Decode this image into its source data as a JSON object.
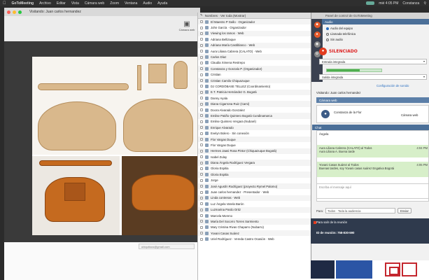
{
  "menubar": {
    "app": "GoToMeeting",
    "items": [
      "Archivo",
      "Editar",
      "Vista",
      "Cámara web",
      "Zoom",
      "Ventana",
      "Audio",
      "Ayuda"
    ],
    "clock": "mié 4:05 PM",
    "user": "Constanza"
  },
  "viewer": {
    "title": "Visitando: Juan carlos hernandez",
    "tool_label": "Cámara web",
    "bottom_chip": "ubiquitous@gmail.com"
  },
  "plist": {
    "header": "Nombres · Ver toda (Mostrar)",
    "participants": [
      "El Maestro P Gallo · Organizador",
      "John García · Organizador",
      "Viewing los ramos · Web",
      "Adriana Bellizaque",
      "Adriana María Castiblanco · Web",
      "Aura Liliana Cabrera (CALATO) · Web",
      "Carlos Díaz",
      "Claudia Ximena Restrepo",
      "Constanza y Gonzalo P. (Organizador)",
      "Cristian",
      "Cristian Camilo Chiquazuque",
      "DJ CORDÓBASE TELLEZ (Coordinamiento)",
      "E.T. Patricia Hernández G. Bogotá",
      "Danny Ayala",
      "Diana Cigarrona Ruiz (Cami)",
      "Doora Alvarado Gonzalez",
      "Emilse Patiño Quintero Bogotá Cundinamarca",
      "Emilse Quintero Vergara (Nubaré)",
      "Enrique Alvarado",
      "Evelyn Bolero · Sin conexión",
      "Flor Vargas Duque",
      "Flor Vargas Duque",
      "Hermes Jaasi Rosa Pintor (Chiquazuque Bogotá)",
      "Isabel Zulay",
      "Diana Ángela Rodríguez Vergara",
      "Gloria Espitia",
      "Gloria Espitia",
      "Jorge",
      "José Agustín Rodríguez (proyecto Rymel Palomo)",
      "Juan carlos hernandez · Presentador · Web",
      "Linda contreras · Web",
      "Luz Ángela Varela Barón",
      "Luzmarina Pardo Ortiz",
      "Marcela Moreno",
      "María Del Socorro Torres Sarmiento",
      "Mary Cristina Rivas Chaparro (Nubarro)",
      "Yovani Casas Suárez",
      "Uriel Rodríguez · Vereda Castro Ocasión · Web"
    ]
  },
  "gtm": {
    "title": "Panel de control de GoToMeeting",
    "audio": {
      "header": "Audio",
      "opt_computer": "Audio del equipo",
      "opt_phone": "Llamada telefónica",
      "opt_none": "Sin audio",
      "muted": "SILENCIADO",
      "mic_select": "Entrada integrada",
      "speaker_select": "Salida integrada",
      "settings_link": "Configuración de sonido",
      "level_percent": 60
    },
    "webcam": {
      "presenter_line": "Visitando: Juan carlos hernandez",
      "header": "Cámara web",
      "org_name": "Constanza de la Flor",
      "org_sub": "Cámara web"
    },
    "chat": {
      "header": "Chat",
      "first_line": "Ángela",
      "msg1": "Aura Liliana Cabrera (CALATO) al Todos",
      "msg1_time": "4:04 PM",
      "msg1_body": "Aura Liliana A. Buena tarde",
      "msg2": "Yovani Casas Suárez al Todos",
      "msg2_time": "4:05 PM",
      "msg2_body": "Buenas tardes, soy Yovani casas suárez Engativa Bogotá",
      "input_placeholder": "Escriba el mensaje aquí",
      "send_to_label": "Para:",
      "send_to_value": "Todos · Toda la audiencia",
      "send_button": "Enviar"
    },
    "footer": {
      "line1": "Para salir de la reunión",
      "line2": "ID de reunión: 758-830-590"
    }
  },
  "colors": {
    "accent": "#e23b1f",
    "section_header": "#4b6f98",
    "chat_green": "#d7efc9",
    "leather": "#c56a1f"
  }
}
